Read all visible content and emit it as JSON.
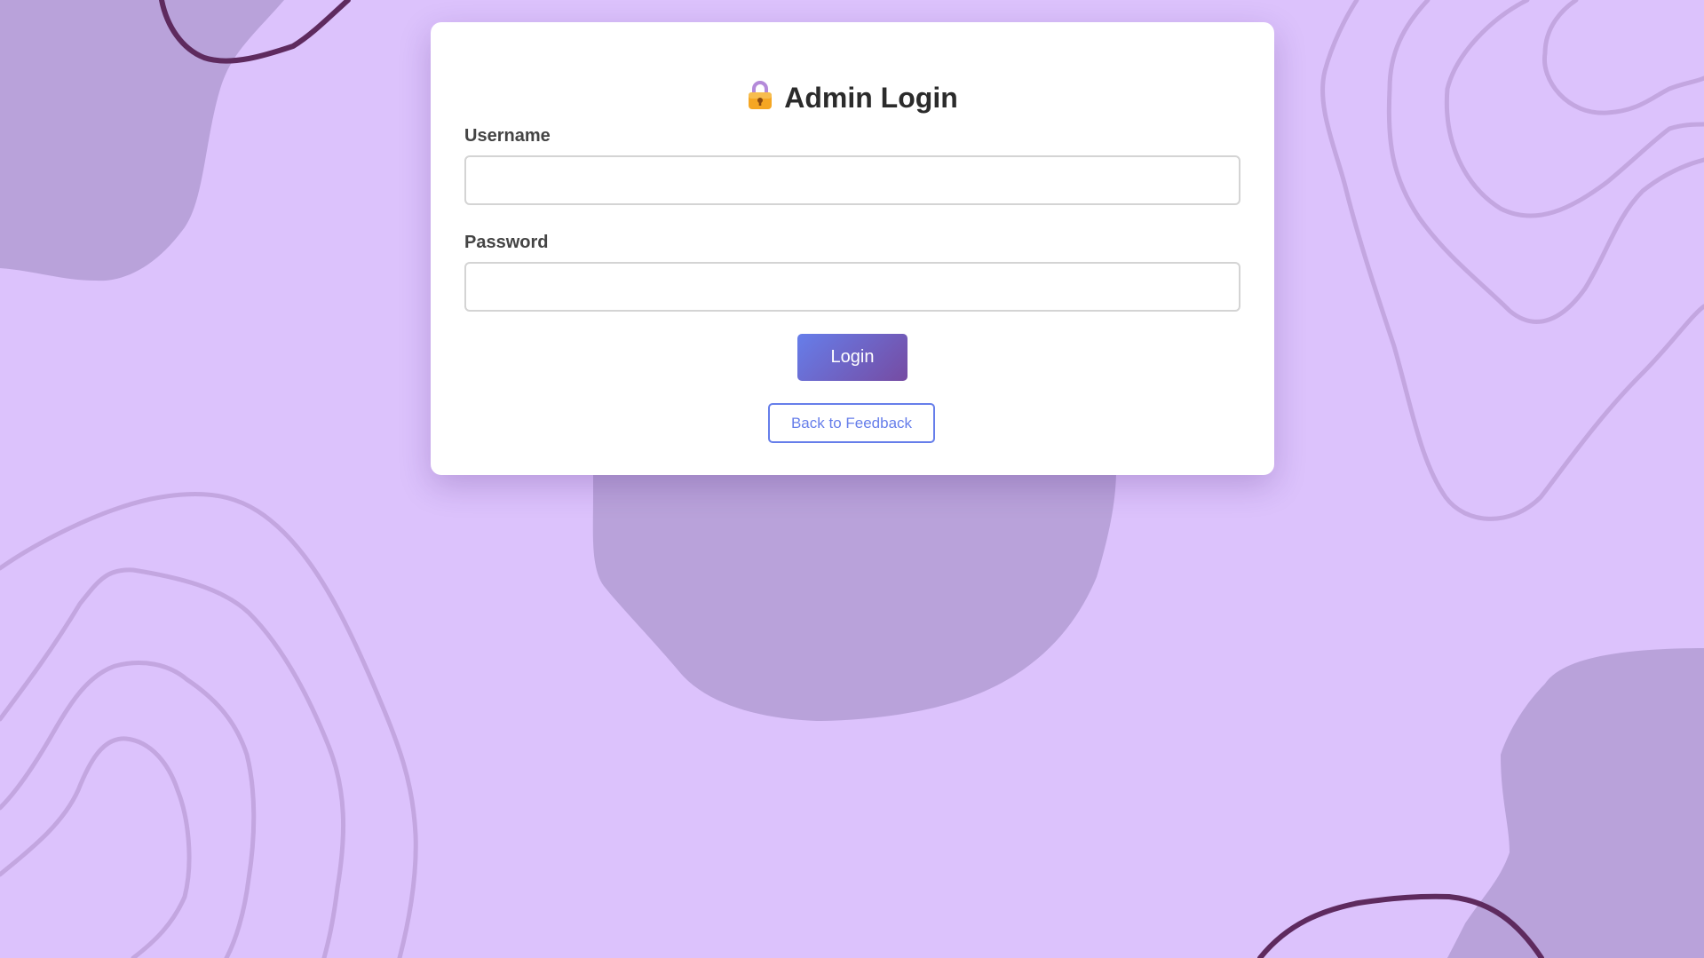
{
  "page": {
    "title": "Admin Login",
    "title_icon": "lock-icon"
  },
  "form": {
    "username_label": "Username",
    "username_value": "",
    "password_label": "Password",
    "password_value": "",
    "login_label": "Login",
    "back_label": "Back to Feedback"
  },
  "colors": {
    "background": "#dcc2fc",
    "blob": "#b9a2da",
    "contour_light": "#c3a6e0",
    "contour_dark": "#5e2a5e",
    "card": "#ffffff",
    "accent_start": "#667eea",
    "accent_end": "#764ba2",
    "heading_text": "#2b2b2b",
    "label_text": "#444444"
  }
}
